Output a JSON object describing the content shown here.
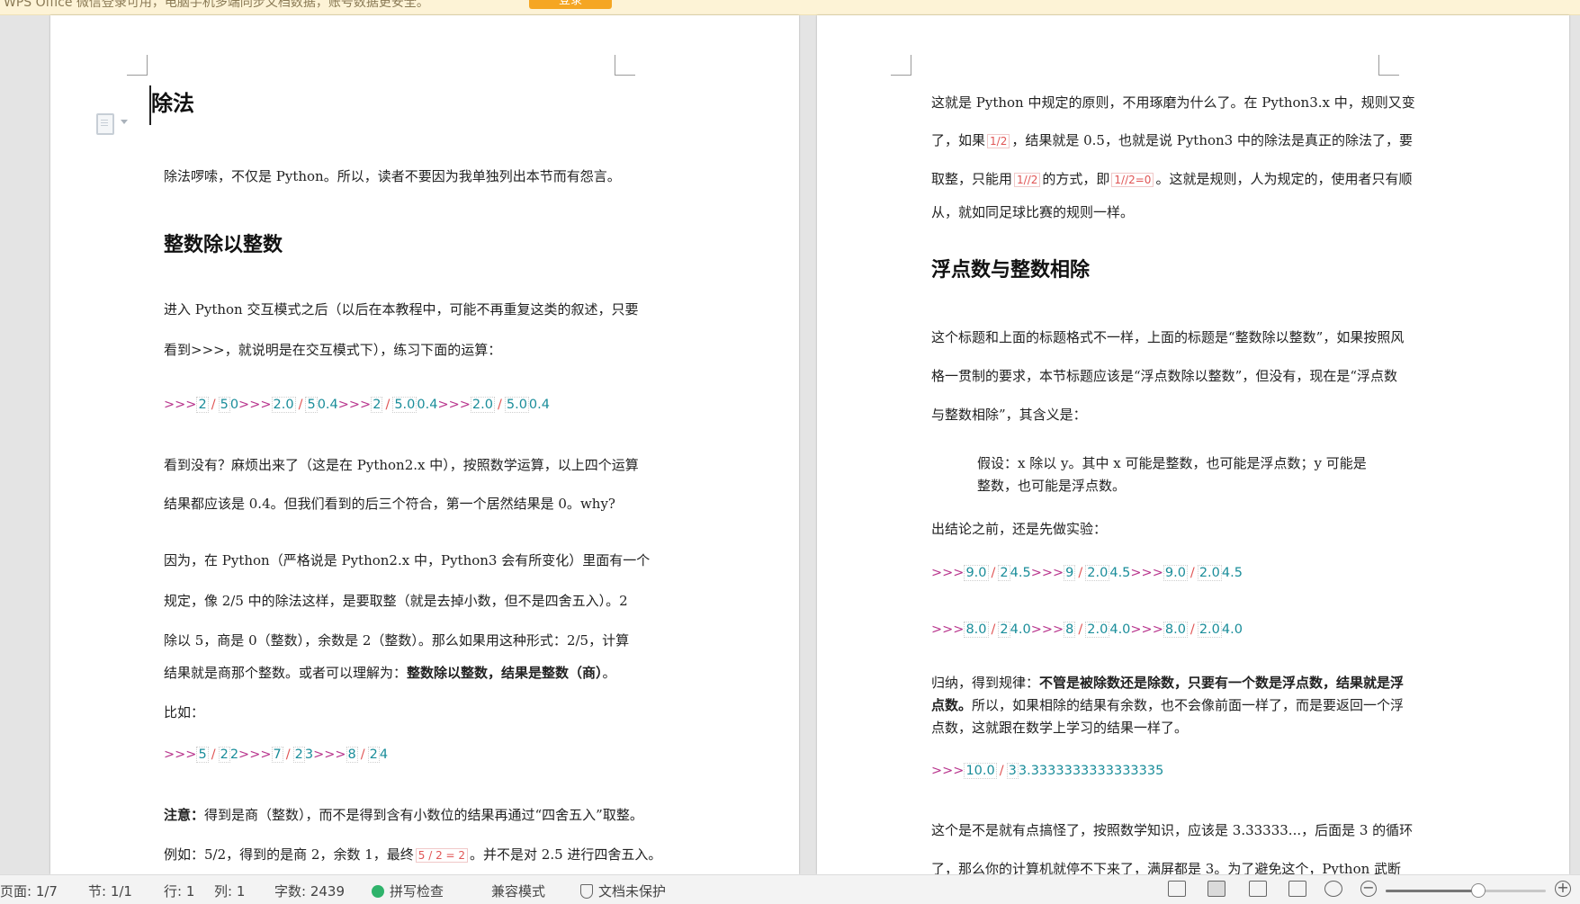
{
  "notice": {
    "text": "WPS Office 微信登录可用，电脑手机多端同步文档数据，账号数据更安全。",
    "button": "登录"
  },
  "left_page": {
    "title": "除法",
    "intro": "除法啰嗦，不仅是 Python。所以，读者不要因为我单独列出本节而有怨言。",
    "h2": "整数除以整数",
    "p1a": "进入 Python 交互模式之后（以后在本教程中，可能不再重复这类的叙述，只要",
    "p1b": "看到>>>，就说明是在交互模式下），练习下面的运算：",
    "code1": [
      {
        "prompt": ">>>",
        "a": "2",
        "op": "/",
        "b": "5",
        "out": "0"
      },
      {
        "prompt": ">>>",
        "a": "2.0",
        "op": "/",
        "b": "5",
        "out": "0.4"
      },
      {
        "prompt": ">>>",
        "a": "2",
        "op": "/",
        "b": "5.0",
        "out": "0.4"
      },
      {
        "prompt": ">>>",
        "a": "2.0",
        "op": "/",
        "b": "5.0",
        "out": "0.4"
      }
    ],
    "p2a": "看到没有？麻烦出来了（这是在 Python2.x 中），按照数学运算，以上四个运算",
    "p2b": "结果都应该是 0.4。但我们看到的后三个符合，第一个居然结果是 0。why?",
    "p3a": "因为，在 Python（严格说是 Python2.x 中，Python3 会有所变化）里面有一个",
    "p3b": "规定，像 2/5 中的除法这样，是要取整（就是去掉小数，但不是四舍五入）。2",
    "p3c": "除以 5，商是 0（整数），余数是 2（整数）。那么如果用这种形式：2/5，计算",
    "p3d_a": "结果就是商那个整数。或者可以理解为：",
    "p3d_b": "整数除以整数，结果是整数（商）",
    "p3d_c": "。",
    "p4": "比如：",
    "code2": [
      {
        "prompt": ">>>",
        "a": "5",
        "op": "/",
        "b": "2",
        "out": "2"
      },
      {
        "prompt": ">>>",
        "a": "7",
        "op": "/",
        "b": "2",
        "out": "3"
      },
      {
        "prompt": ">>>",
        "a": "8",
        "op": "/",
        "b": "2",
        "out": "4"
      }
    ],
    "note_label": "注意：",
    "note_a": "得到是商（整数），而不是得到含有小数位的结果再通过“四舍五入”取整。",
    "note_b1": "例如：5/2，得到的是商 2，余数 1，最终",
    "note_b_code": "5 / 2 = 2",
    "note_b2": "。并不是对 2.5 进行四舍五入。"
  },
  "right_page": {
    "p1a": "这就是 Python 中规定的原则，不用琢磨为什么了。在 Python3.x 中，规则又变",
    "p1b1": "了，如果",
    "p1b_code": "1/2",
    "p1b2": "，结果就是 0.5，也就是说 Python3 中的除法是真正的除法了，要",
    "p1c1": "取整，只能用",
    "p1c_code1": "1//2",
    "p1c2": "的方式，即",
    "p1c_code2": "1//2=0",
    "p1c3": "。这就是规则，人为规定的，使用者只有顺",
    "p1d": "从，就如同足球比赛的规则一样。",
    "h2": "浮点数与整数相除",
    "p2a": "这个标题和上面的标题格式不一样，上面的标题是“整数除以整数”，如果按照风",
    "p2b": "格一贯制的要求，本节标题应该是“浮点数除以整数”，但没有，现在是“浮点数",
    "p2c": "与整数相除”，其含义是：",
    "quote_a": "假设：x 除以 y。其中 x 可能是整数，也可能是浮点数；y 可能是",
    "quote_b": "整数，也可能是浮点数。",
    "p3": "出结论之前，还是先做实验：",
    "code3": [
      {
        "prompt": ">>>",
        "a": "9.0",
        "op": "/",
        "b": "2",
        "out": "4.5"
      },
      {
        "prompt": ">>>",
        "a": "9",
        "op": "/",
        "b": "2.0",
        "out": "4.5"
      },
      {
        "prompt": ">>>",
        "a": "9.0",
        "op": "/",
        "b": "2.0",
        "out": "4.5"
      }
    ],
    "code4": [
      {
        "prompt": ">>>",
        "a": "8.0",
        "op": "/",
        "b": "2",
        "out": "4.0"
      },
      {
        "prompt": ">>>",
        "a": "8",
        "op": "/",
        "b": "2.0",
        "out": "4.0"
      },
      {
        "prompt": ">>>",
        "a": "8.0",
        "op": "/",
        "b": "2.0",
        "out": "4.0"
      }
    ],
    "p4a_1": "归纳，得到规律：",
    "p4a_b": "不管是被除数还是除数，只要有一个数是浮点数，结果就是浮",
    "p4b_b": "点数。",
    "p4b_2": "所以，如果相除的结果有余数，也不会像前面一样了，而是要返回一个浮",
    "p4c": "点数，这就跟在数学上学习的结果一样了。",
    "code5": [
      {
        "prompt": ">>>",
        "a": "10.0",
        "op": "/",
        "b": "3",
        "out": "3.3333333333333335"
      }
    ],
    "p5a": "这个是不是就有点搞怪了，按照数学知识，应该是 3.33333...，后面是 3 的循环",
    "p5b": "了，那么你的计算机就停不下来了，满屏都是 3。为了避免这个，Python 武断"
  },
  "status_bar": {
    "page": "页面: 1/7",
    "section": "节: 1/1",
    "line": "行: 1",
    "column": "列: 1",
    "word_count": "字数: 2439",
    "spell_check": "拼写检查",
    "compat_mode": "兼容模式",
    "protection": "文档未保护",
    "zoom_level": 0.58
  }
}
